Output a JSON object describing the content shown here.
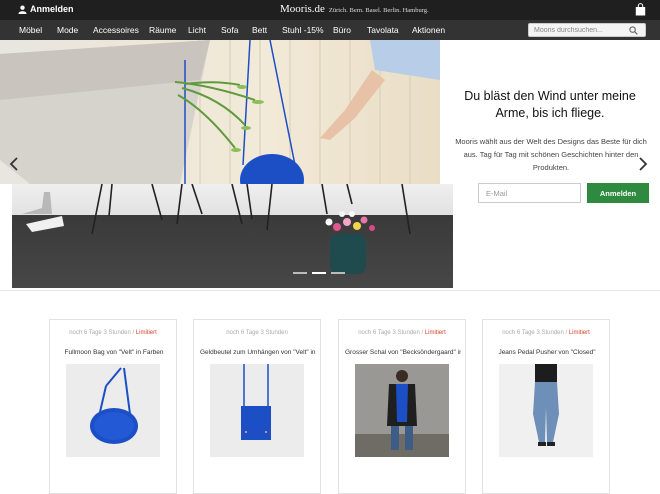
{
  "topbar": {
    "login_label": "Anmelden",
    "brand": "Mooris.de",
    "cities": "Zürich. Bern. Basel. Berlin. Hamburg."
  },
  "nav": {
    "items": [
      "Möbel",
      "Mode",
      "Accessoires",
      "Räume",
      "Licht",
      "Sofa",
      "Bett",
      "Stuhl -15%",
      "Büro",
      "Tavolata",
      "Aktionen"
    ],
    "search_placeholder": "Mooris durchsuchen..."
  },
  "hero": {
    "headline": "Du bläst den Wind unter meine Arme, bis ich fliege.",
    "description": "Mooris wählt aus der Welt des Designs das Beste für dich aus. Tag für Tag mit schönen Geschichten hinter den Produkten.",
    "email_placeholder": "E-Mail",
    "signup_label": "Anmelden",
    "slide_count": 3,
    "active_slide": 1
  },
  "products": [
    {
      "timer": "noch 6 Tage 3 Stunden / ",
      "limited": "Limitiert",
      "title": "Fullmoon Bag von \"Velt\" in Farben"
    },
    {
      "timer": "noch 6 Tage 3 Stunden",
      "limited": "",
      "title": "Geldbeutel zum Umhängen von \"Velt\" in B"
    },
    {
      "timer": "noch 6 Tage 3 Stunden / ",
      "limited": "Limitiert",
      "title": "Grosser Schal von \"Becksöndergaard\" in Bl"
    },
    {
      "timer": "noch 6 Tage 3 Stunden / ",
      "limited": "Limitiert",
      "title": "Jeans Pedal Pusher von \"Closed\""
    }
  ],
  "colors": {
    "topbar": "#1f1f1f",
    "nav": "#333333",
    "accent_green": "#2d8a3e",
    "limited_red": "#d2452f",
    "product_blue": "#1c4fc6"
  }
}
